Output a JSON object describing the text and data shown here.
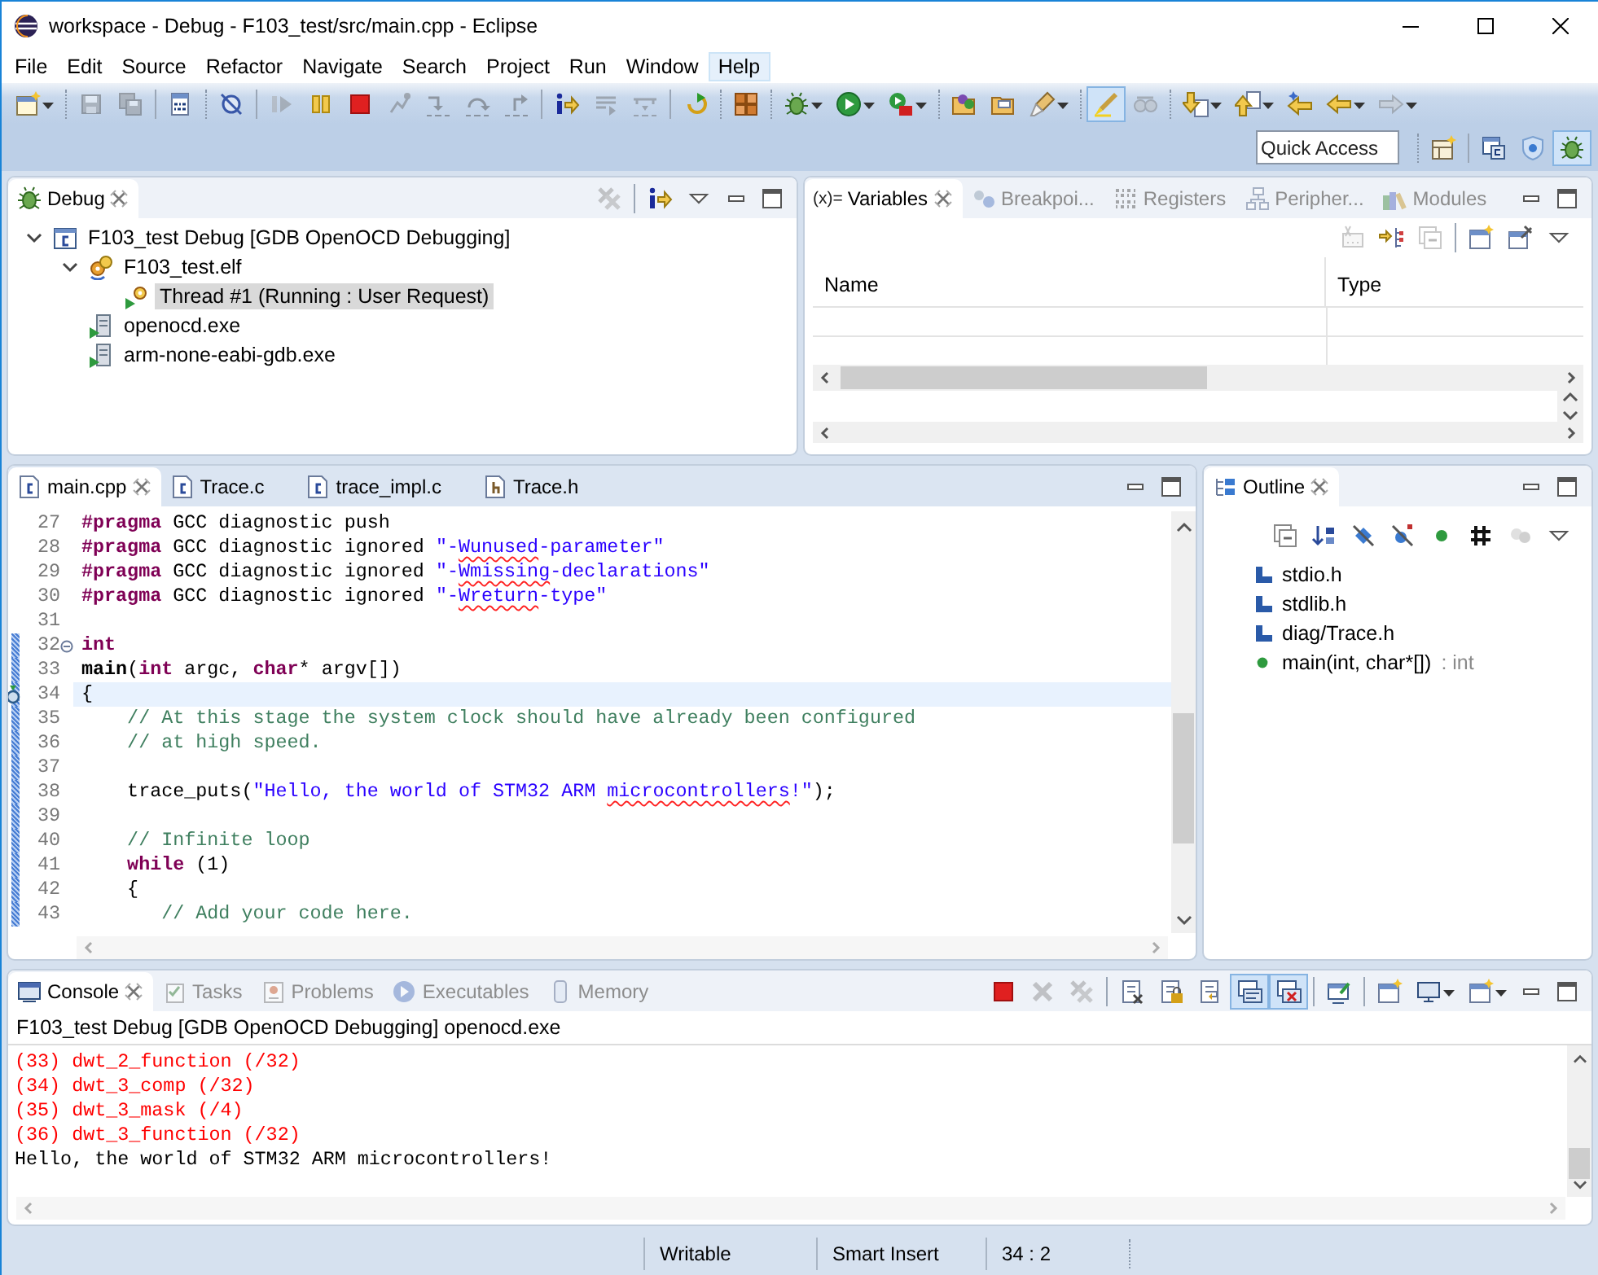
{
  "window": {
    "title": "workspace - Debug - F103_test/src/main.cpp - Eclipse"
  },
  "menu": [
    {
      "label": "File",
      "selected": false
    },
    {
      "label": "Edit",
      "selected": false
    },
    {
      "label": "Source",
      "selected": false
    },
    {
      "label": "Refactor",
      "selected": false
    },
    {
      "label": "Navigate",
      "selected": false
    },
    {
      "label": "Search",
      "selected": false
    },
    {
      "label": "Project",
      "selected": false
    },
    {
      "label": "Run",
      "selected": false
    },
    {
      "label": "Window",
      "selected": false
    },
    {
      "label": "Help",
      "selected": true
    }
  ],
  "toolbar": [
    {
      "disabled": false,
      "pressed": false
    },
    {
      "disabled": true,
      "pressed": false
    },
    {
      "disabled": true,
      "pressed": false
    },
    {
      "disabled": false,
      "pressed": false
    },
    {
      "disabled": false,
      "pressed": false
    },
    {
      "disabled": true,
      "pressed": false
    },
    {
      "disabled": false,
      "pressed": false
    },
    {
      "disabled": false,
      "pressed": false
    },
    {
      "disabled": true,
      "pressed": false
    },
    {
      "disabled": true,
      "pressed": false
    },
    {
      "disabled": true,
      "pressed": false
    },
    {
      "disabled": true,
      "pressed": false
    },
    {
      "disabled": false,
      "pressed": false
    },
    {
      "disabled": true,
      "pressed": false
    },
    {
      "disabled": true,
      "pressed": false
    },
    {
      "disabled": false,
      "pressed": false
    },
    {
      "disabled": false,
      "pressed": false
    },
    {
      "disabled": false,
      "pressed": false
    },
    {
      "disabled": false,
      "pressed": false
    },
    {
      "disabled": false,
      "pressed": false
    },
    {
      "disabled": false,
      "pressed": false
    },
    {
      "disabled": false,
      "pressed": false
    },
    {
      "disabled": false,
      "pressed": false
    },
    {
      "disabled": false,
      "pressed": true
    },
    {
      "disabled": true,
      "pressed": false
    },
    {
      "disabled": false,
      "pressed": false
    },
    {
      "disabled": false,
      "pressed": false
    },
    {
      "disabled": false,
      "pressed": false
    },
    {
      "disabled": false,
      "pressed": false
    },
    {
      "disabled": true,
      "pressed": false
    }
  ],
  "quick_access": {
    "placeholder": "Quick Access"
  },
  "perspectives": [
    {
      "disabled": false,
      "pressed": false
    },
    {
      "disabled": false,
      "pressed": false
    },
    {
      "disabled": false,
      "pressed": false
    },
    {
      "disabled": false,
      "pressed": true
    }
  ],
  "debug_view": {
    "tabs": [
      {
        "label": "Debug",
        "selected": true
      }
    ],
    "toolbar": [
      {
        "disabled": true,
        "pressed": false
      },
      {
        "disabled": false,
        "pressed": false
      },
      {
        "disabled": false,
        "pressed": false
      }
    ],
    "tree": [
      {
        "label": "F103_test Debug [GDB OpenOCD Debugging]",
        "kind": "launch",
        "expanded": true,
        "selected": false,
        "children": [
          {
            "label": "F103_test.elf",
            "kind": "program",
            "expanded": true,
            "selected": false,
            "children": [
              {
                "label": "Thread #1 (Running : User Request)",
                "kind": "thread",
                "selected": true
              }
            ]
          },
          {
            "label": "openocd.exe",
            "kind": "process",
            "selected": false
          },
          {
            "label": "arm-none-eabi-gdb.exe",
            "kind": "process",
            "selected": false
          }
        ]
      }
    ]
  },
  "variables_view": {
    "tabs": [
      {
        "icon_text": "(x)=",
        "label": "Variables",
        "selected": true
      },
      {
        "label": "Breakpoi...",
        "selected": false
      },
      {
        "label": "Registers",
        "selected": false
      },
      {
        "label": "Peripher...",
        "selected": false
      },
      {
        "label": "Modules",
        "selected": false
      }
    ],
    "toolbar": [
      {
        "disabled": true,
        "pressed": false
      },
      {
        "disabled": false,
        "pressed": false
      },
      {
        "disabled": true,
        "pressed": false
      },
      {
        "disabled": false,
        "pressed": false
      },
      {
        "disabled": false,
        "pressed": false
      },
      {
        "disabled": false,
        "pressed": false
      }
    ],
    "table": {
      "columns": [
        "Name",
        "Type"
      ]
    }
  },
  "editor": {
    "tabs": [
      {
        "label": "main.cpp",
        "kind": "source",
        "selected": true
      },
      {
        "label": "Trace.c",
        "kind": "source",
        "selected": false
      },
      {
        "label": "trace_impl.c",
        "kind": "source",
        "selected": false
      },
      {
        "label": "Trace.h",
        "kind": "header",
        "selected": false
      }
    ],
    "lines": [
      {
        "number": "27",
        "range": false,
        "current": false,
        "fold": false,
        "tokens": [
          {
            "kind": "keyword",
            "text": "#pragma"
          },
          {
            "kind": "plain",
            "text": " GCC diagnostic push"
          }
        ]
      },
      {
        "number": "28",
        "range": false,
        "current": false,
        "fold": false,
        "tokens": [
          {
            "kind": "keyword",
            "text": "#pragma"
          },
          {
            "kind": "plain",
            "text": " GCC diagnostic ignored "
          },
          {
            "kind": "string",
            "text": "\"-"
          },
          {
            "kind": "typo",
            "text": "Wunused"
          },
          {
            "kind": "string",
            "text": "-parameter\""
          }
        ]
      },
      {
        "number": "29",
        "range": false,
        "current": false,
        "fold": false,
        "tokens": [
          {
            "kind": "keyword",
            "text": "#pragma"
          },
          {
            "kind": "plain",
            "text": " GCC diagnostic ignored "
          },
          {
            "kind": "string",
            "text": "\"-"
          },
          {
            "kind": "typo",
            "text": "Wmissing"
          },
          {
            "kind": "string",
            "text": "-declarations\""
          }
        ]
      },
      {
        "number": "30",
        "range": false,
        "current": false,
        "fold": false,
        "tokens": [
          {
            "kind": "keyword",
            "text": "#pragma"
          },
          {
            "kind": "plain",
            "text": " GCC diagnostic ignored "
          },
          {
            "kind": "string",
            "text": "\"-"
          },
          {
            "kind": "typo",
            "text": "Wreturn"
          },
          {
            "kind": "string",
            "text": "-type\""
          }
        ]
      },
      {
        "number": "31",
        "range": false,
        "current": false,
        "fold": false
      },
      {
        "number": "32",
        "range": true,
        "current": false,
        "fold": true,
        "tokens": [
          {
            "kind": "keyword",
            "text": "int"
          }
        ]
      },
      {
        "number": "33",
        "range": true,
        "current": false,
        "fold": false,
        "tokens": [
          {
            "kind": "function",
            "text": "main"
          },
          {
            "kind": "plain",
            "text": "("
          },
          {
            "kind": "keyword",
            "text": "int"
          },
          {
            "kind": "plain",
            "text": " argc, "
          },
          {
            "kind": "keyword",
            "text": "char"
          },
          {
            "kind": "plain",
            "text": "* argv[])"
          }
        ]
      },
      {
        "number": "34",
        "range": true,
        "current": true,
        "fold": false,
        "tokens": [
          {
            "kind": "plain",
            "text": "{"
          }
        ]
      },
      {
        "number": "35",
        "range": true,
        "current": false,
        "fold": false,
        "tokens": [
          {
            "kind": "comment",
            "text": "    // At this stage the system clock should have already been configured"
          }
        ]
      },
      {
        "number": "36",
        "range": true,
        "current": false,
        "fold": false,
        "tokens": [
          {
            "kind": "comment",
            "text": "    // at high speed."
          }
        ]
      },
      {
        "number": "37",
        "range": true,
        "current": false,
        "fold": false
      },
      {
        "number": "38",
        "range": true,
        "current": false,
        "fold": false,
        "tokens": [
          {
            "kind": "plain",
            "text": "    trace_puts("
          },
          {
            "kind": "string",
            "text": "\"Hello, the world of STM32 ARM "
          },
          {
            "kind": "typo",
            "text": "microcontrollers"
          },
          {
            "kind": "string",
            "text": "!\""
          },
          {
            "kind": "plain",
            "text": ");"
          }
        ]
      },
      {
        "number": "39",
        "range": true,
        "current": false,
        "fold": false
      },
      {
        "number": "40",
        "range": true,
        "current": false,
        "fold": false,
        "tokens": [
          {
            "kind": "comment",
            "text": "    // Infinite loop"
          }
        ]
      },
      {
        "number": "41",
        "range": true,
        "current": false,
        "fold": false,
        "tokens": [
          {
            "kind": "keyword",
            "text": "    while"
          },
          {
            "kind": "plain",
            "text": " (1)"
          }
        ]
      },
      {
        "number": "42",
        "range": true,
        "current": false,
        "fold": false,
        "tokens": [
          {
            "kind": "plain",
            "text": "    {"
          }
        ]
      },
      {
        "number": "43",
        "range": true,
        "current": false,
        "fold": false,
        "tokens": [
          {
            "kind": "comment",
            "text": "       // Add your code here."
          }
        ]
      }
    ]
  },
  "outline": {
    "tabs": [
      {
        "label": "Outline",
        "selected": true
      }
    ],
    "toolbar": [
      {
        "disabled": false,
        "pressed": false
      },
      {
        "disabled": false,
        "pressed": false
      },
      {
        "disabled": false,
        "pressed": false
      },
      {
        "disabled": false,
        "pressed": false
      },
      {
        "disabled": false,
        "pressed": false
      },
      {
        "disabled": false,
        "pressed": false
      },
      {
        "disabled": true,
        "pressed": false
      },
      {
        "disabled": false,
        "pressed": false
      }
    ],
    "items": [
      {
        "kind": "include",
        "label": "stdio.h"
      },
      {
        "kind": "include",
        "label": "stdlib.h"
      },
      {
        "kind": "include",
        "label": "diag/Trace.h"
      },
      {
        "kind": "function",
        "label": "main(int, char*[])",
        "type": ": int"
      }
    ]
  },
  "console_view": {
    "tabs": [
      {
        "label": "Console",
        "selected": true
      },
      {
        "label": "Tasks",
        "selected": false
      },
      {
        "label": "Problems",
        "selected": false
      },
      {
        "label": "Executables",
        "selected": false
      },
      {
        "label": "Memory",
        "selected": false
      }
    ],
    "toolbar": [
      {
        "disabled": false,
        "pressed": false
      },
      {
        "disabled": true,
        "pressed": false
      },
      {
        "disabled": true,
        "pressed": false
      },
      {
        "disabled": false,
        "pressed": false
      },
      {
        "disabled": false,
        "pressed": false
      },
      {
        "disabled": false,
        "pressed": false
      },
      {
        "disabled": false,
        "pressed": true
      },
      {
        "disabled": false,
        "pressed": true
      },
      {
        "disabled": false,
        "pressed": false
      },
      {
        "disabled": false,
        "pressed": false
      },
      {
        "disabled": false,
        "pressed": false
      },
      {
        "disabled": false,
        "pressed": false
      }
    ],
    "description": "F103_test Debug [GDB OpenOCD Debugging] openocd.exe",
    "lines": [
      {
        "kind": "error",
        "text": "(33) dwt_2_function (/32)"
      },
      {
        "kind": "error",
        "text": "(34) dwt_3_comp (/32)"
      },
      {
        "kind": "error",
        "text": "(35) dwt_3_mask (/4)"
      },
      {
        "kind": "error",
        "text": "(36) dwt_3_function (/32)"
      },
      {
        "kind": "output",
        "text": "Hello, the world of STM32 ARM microcontrollers!"
      }
    ]
  },
  "status_bar": {
    "fields": [
      "Writable",
      "Smart Insert",
      "34 : 2"
    ]
  }
}
